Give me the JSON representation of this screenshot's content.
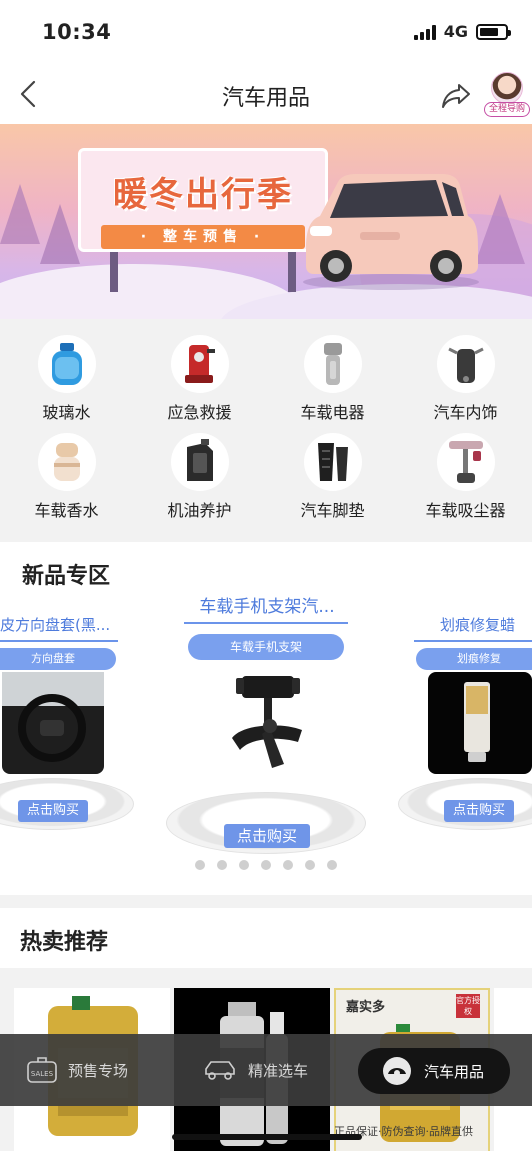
{
  "status_bar": {
    "time": "10:34",
    "network": "4G",
    "battery_level": 0.75
  },
  "nav": {
    "title": "汽车用品",
    "guide_label": "全程导购"
  },
  "banner": {
    "title": "暖冬出行季",
    "subtitle": "· 整车预售 ·"
  },
  "categories": [
    {
      "label": "玻璃水",
      "icon": "washer-fluid-icon"
    },
    {
      "label": "应急救援",
      "icon": "emergency-kit-icon"
    },
    {
      "label": "车载电器",
      "icon": "car-charger-icon"
    },
    {
      "label": "汽车内饰",
      "icon": "phone-mount-icon"
    },
    {
      "label": "车载香水",
      "icon": "car-perfume-icon"
    },
    {
      "label": "机油养护",
      "icon": "engine-oil-icon"
    },
    {
      "label": "汽车脚垫",
      "icon": "floor-mat-icon"
    },
    {
      "label": "车载吸尘器",
      "icon": "vacuum-icon"
    }
  ],
  "new_zone": {
    "title": "新品专区",
    "cards": [
      {
        "title": "皮方向盘套(黑...",
        "tag": "方向盘套",
        "buy": "点击购买"
      },
      {
        "title": "车载手机支架汽...",
        "tag": "车载手机支架",
        "buy": "点击购买"
      },
      {
        "title": "划痕修复蜡",
        "tag": "划痕修复",
        "buy": "点击购买"
      }
    ],
    "dot_count": 7
  },
  "hot_zone": {
    "title": "热卖推荐",
    "product3_brand": "嘉实多",
    "product3_badge": "官方授权",
    "product3_strip": "正品保证·防伪查询·品牌直供"
  },
  "tab_bar": {
    "items": [
      {
        "label": "预售专场",
        "icon": "sales-tag-icon",
        "icon_text": "SALES"
      },
      {
        "label": "精准选车",
        "icon": "car-outline-icon"
      },
      {
        "label": "汽车用品",
        "icon": "car-accessory-icon"
      }
    ]
  }
}
